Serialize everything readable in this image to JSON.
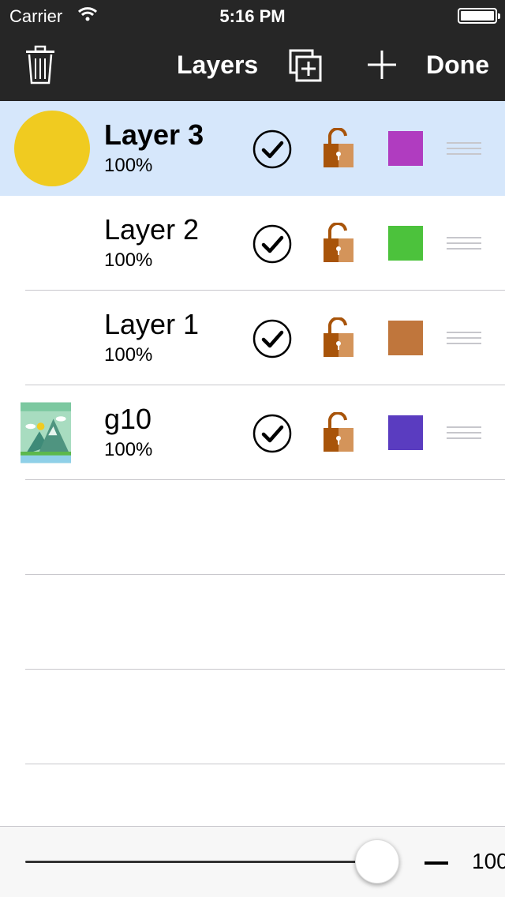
{
  "status_bar": {
    "carrier": "Carrier",
    "time": "5:16 PM"
  },
  "nav": {
    "title": "Layers",
    "done_label": "Done"
  },
  "layers": [
    {
      "name": "Layer 3",
      "opacity": "100%",
      "selected": true,
      "color": "#b03cc0"
    },
    {
      "name": "Layer 2",
      "opacity": "100%",
      "selected": false,
      "color": "#4cc23c"
    },
    {
      "name": "Layer 1",
      "opacity": "100%",
      "selected": false,
      "color": "#c0763c"
    },
    {
      "name": "g10",
      "opacity": "100%",
      "selected": false,
      "color": "#5a3cc0"
    }
  ],
  "icons": [
    "trash-icon",
    "duplicate-layer-icon",
    "plus-icon",
    "checkmark-icon",
    "unlock-icon",
    "drag-handle-icon",
    "minus-icon"
  ],
  "bottom_bar": {
    "opacity_value": "100",
    "slider_level": 1.0
  }
}
